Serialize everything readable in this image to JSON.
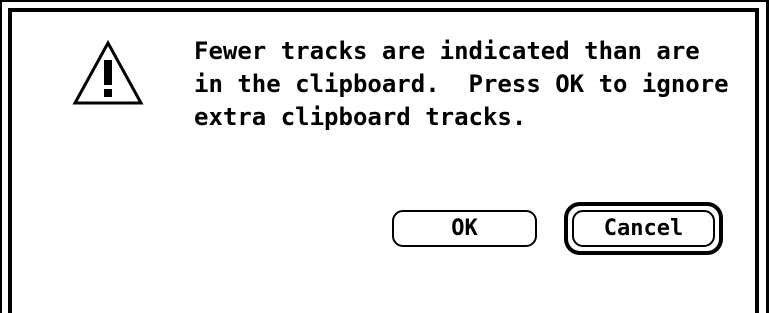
{
  "dialog": {
    "icon": "caution-triangle-icon",
    "message_lines": [
      "Fewer tracks are indicated than are",
      "in the clipboard.  Press OK to ignore",
      "extra clipboard tracks."
    ],
    "buttons": {
      "ok_label": "OK",
      "cancel_label": "Cancel",
      "default": "Cancel"
    }
  },
  "colors": {
    "foreground": "#000000",
    "background": "#ffffff"
  }
}
